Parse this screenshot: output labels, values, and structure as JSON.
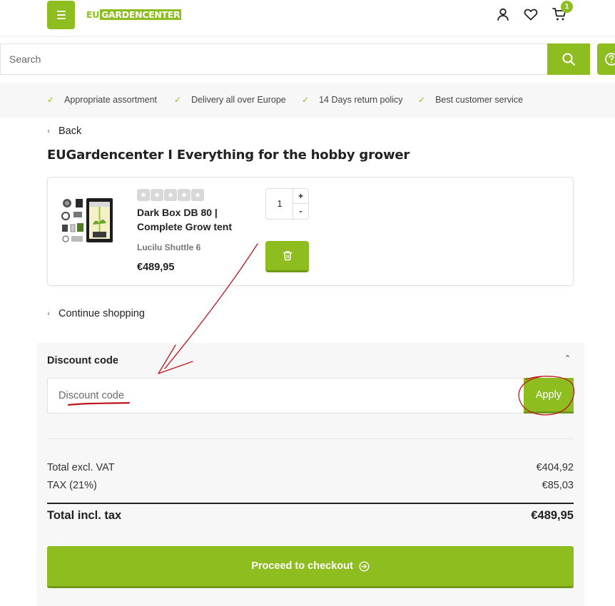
{
  "header": {
    "logo": {
      "eu": "EU",
      "gardencenter": "GARDENCENTER"
    },
    "cart_count": "1"
  },
  "search": {
    "placeholder": "Search"
  },
  "usps": [
    "Appropriate assortment",
    "Delivery all over Europe",
    "14 Days return policy",
    "Best customer service"
  ],
  "nav": {
    "back": "Back",
    "continue_shopping": "Continue shopping"
  },
  "page_title": "EUGardencenter I Everything for the hobby grower",
  "cart_item": {
    "rating_stars": 0,
    "rating_max": 5,
    "name": "Dark Box DB 80 | Complete Grow tent",
    "variant": "Lucilu Shuttle 6",
    "price": "€489,95",
    "quantity": "1",
    "qty_plus": "+",
    "qty_minus": "-"
  },
  "discount": {
    "title": "Discount code",
    "placeholder": "Discount code",
    "apply_label": "Apply"
  },
  "totals": {
    "excl_label": "Total excl. VAT",
    "excl_value": "€404,92",
    "tax_label": "TAX (21%)",
    "tax_value": "€85,03",
    "incl_label": "Total incl. tax",
    "incl_value": "€489,95"
  },
  "checkout": {
    "label": "Proceed to checkout"
  },
  "colors": {
    "brand_green": "#8dbd1f",
    "annotation_red": "#c0141c"
  }
}
